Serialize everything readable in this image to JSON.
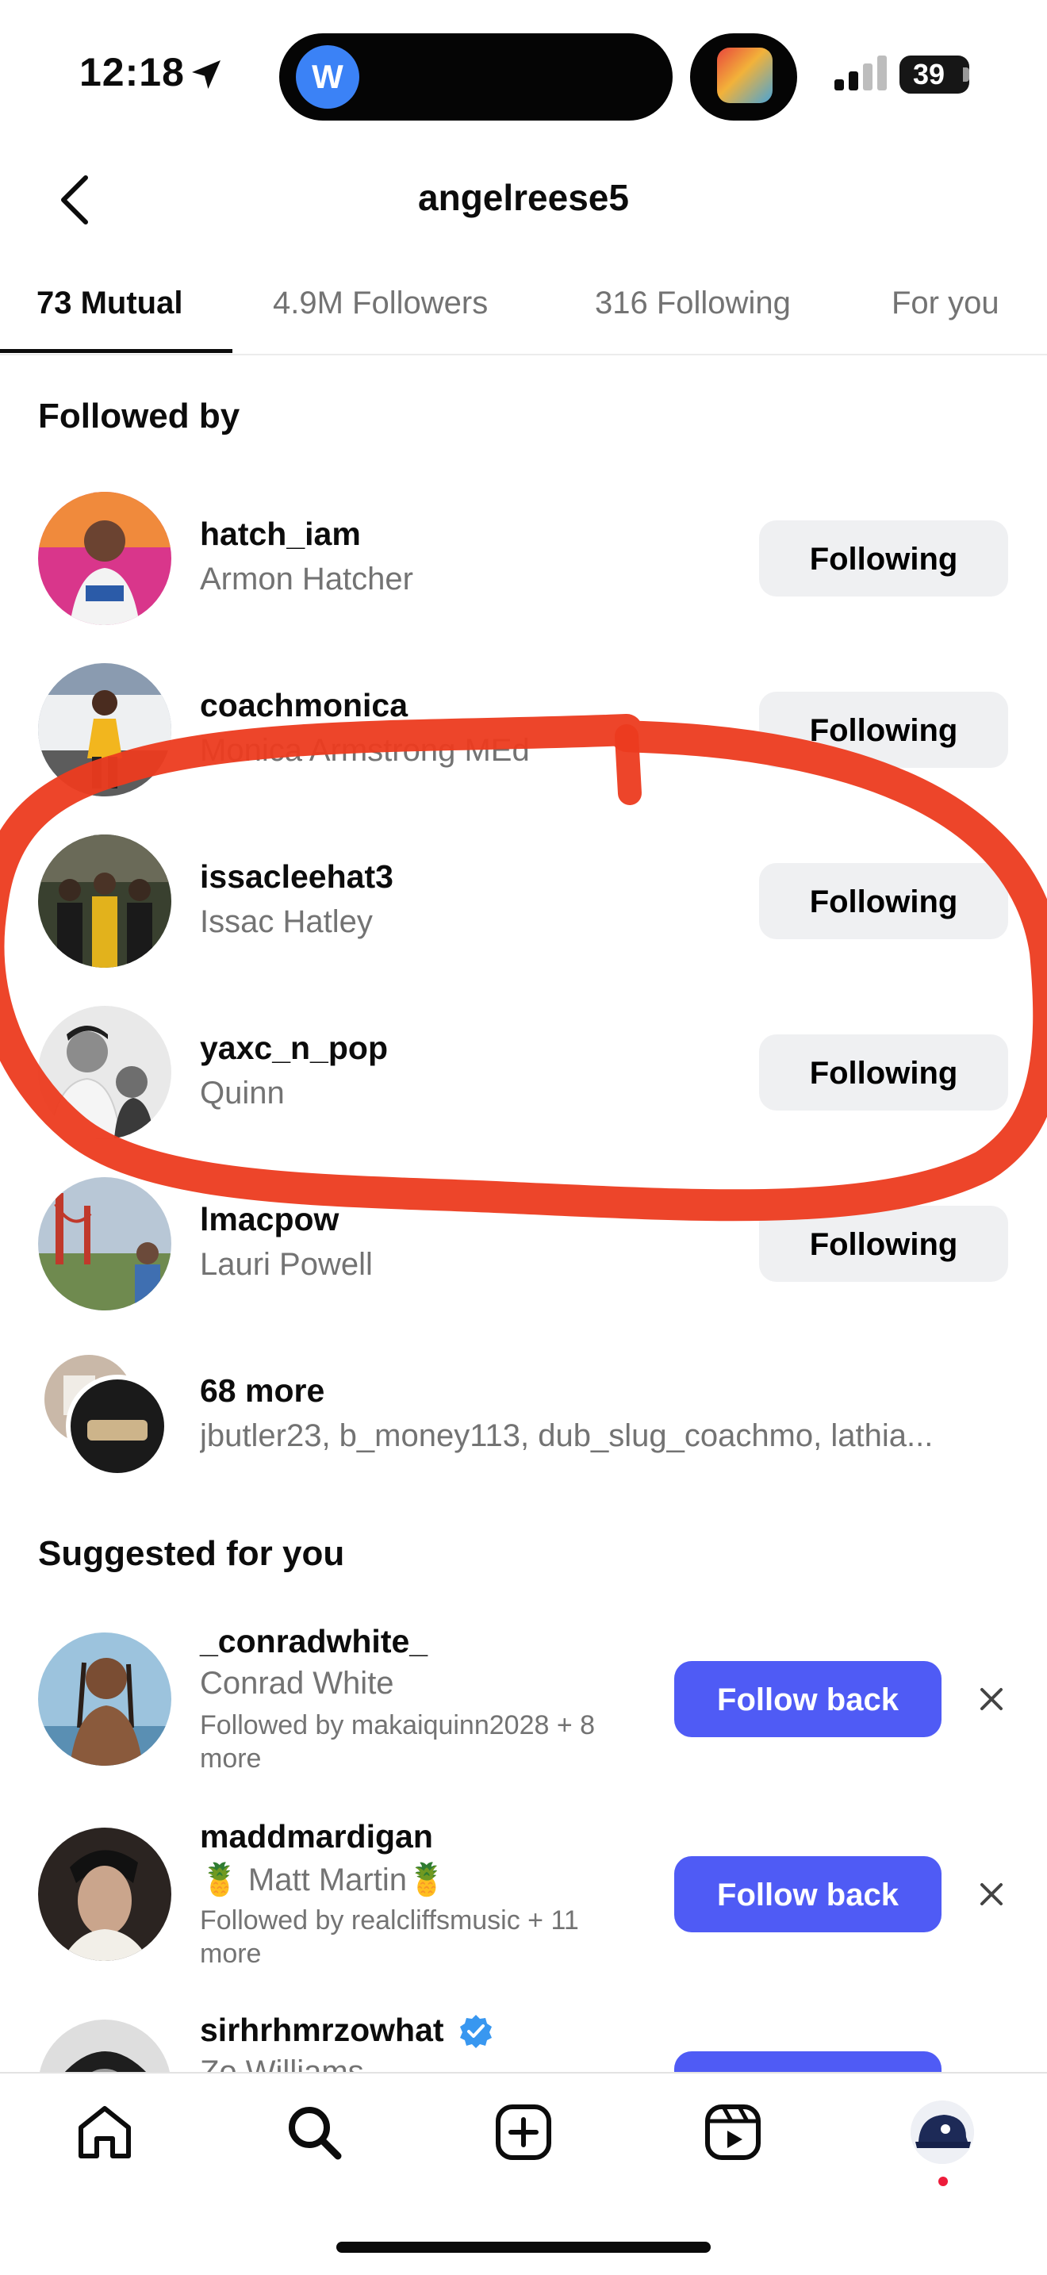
{
  "status_bar": {
    "time": "12:18",
    "island_badge": "W",
    "battery": "39"
  },
  "header": {
    "title": "angelreese5"
  },
  "tabs": [
    {
      "label": "73 Mutual",
      "active": true
    },
    {
      "label": "4.9M Followers",
      "active": false
    },
    {
      "label": "316 Following",
      "active": false
    },
    {
      "label": "For you",
      "active": false
    }
  ],
  "followed_by": {
    "title": "Followed by",
    "users": [
      {
        "username": "hatch_iam",
        "name": "Armon Hatcher",
        "button": "Following"
      },
      {
        "username": "coachmonica",
        "name": "Monica Armstrong MEd",
        "button": "Following"
      },
      {
        "username": "issacleehat3",
        "name": "Issac Hatley",
        "button": "Following"
      },
      {
        "username": "yaxc_n_pop",
        "name": "Quinn",
        "button": "Following"
      },
      {
        "username": "lmacpow",
        "name": "Lauri Powell",
        "button": "Following"
      }
    ],
    "more": {
      "title": "68 more",
      "names": "jbutler23, b_money113, dub_slug_coachmo, lathia..."
    }
  },
  "suggested": {
    "title": "Suggested for you",
    "users": [
      {
        "username": "_conradwhite_",
        "name": "Conrad White",
        "followed_by": "Followed by makaiquinn2028 + 8 more",
        "button": "Follow back"
      },
      {
        "username": "maddmardigan",
        "name": "🍍 Matt Martin🍍",
        "followed_by": "Followed by realcliffsmusic + 11 more",
        "button": "Follow back"
      },
      {
        "username": "sirhrhmrzowhat",
        "name": "Zo Williams",
        "verified": true
      }
    ]
  },
  "bottom_nav": [
    "home-icon",
    "search-icon",
    "create-icon",
    "reels-icon",
    "profile-avatar"
  ],
  "colors": {
    "follow_back": "#4f5bf5",
    "following_bg": "#eff0f2",
    "annotation": "#ec3b1f",
    "verified": "#3897f0"
  }
}
